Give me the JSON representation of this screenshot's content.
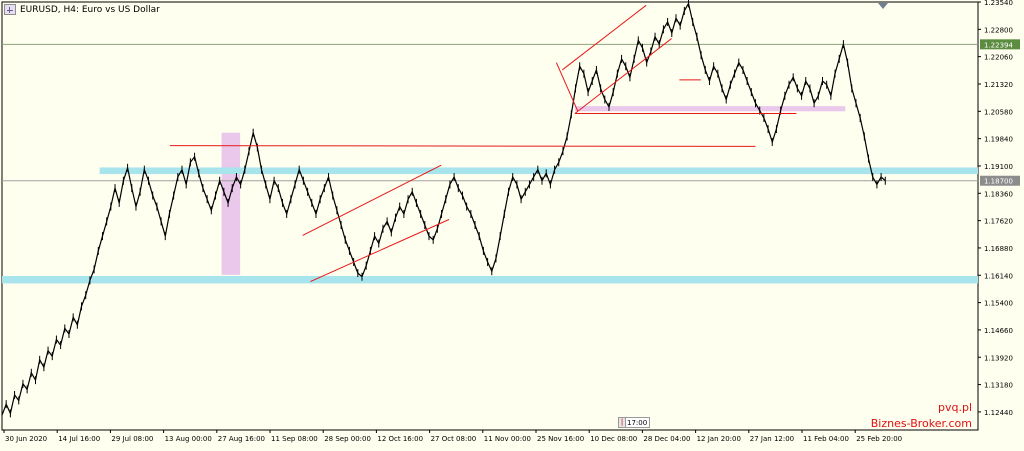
{
  "window": {
    "title": "EURUSD, H4:  Euro vs US Dollar",
    "watermark_line1": "pvq.pl",
    "watermark_line2": "Biznes-Broker.com",
    "scroll_marker_text": "17:00"
  },
  "chart_data": {
    "type": "line",
    "symbol": "EURUSD",
    "timeframe": "H4",
    "description": "Euro vs US Dollar",
    "ylim": [
      1.1195,
      1.2354
    ],
    "y_ticks": [
      "1.23540",
      "1.22800",
      "1.22060",
      "1.21320",
      "1.20580",
      "1.19840",
      "1.19100",
      "1.18360",
      "1.17620",
      "1.16880",
      "1.16140",
      "1.15400",
      "1.14660",
      "1.13920",
      "1.13180",
      "1.12440"
    ],
    "x_ticks": [
      "30 Jun 2020",
      "14 Jul 16:00",
      "29 Jul 08:00",
      "13 Aug 00:00",
      "27 Aug 16:00",
      "11 Sep 08:00",
      "28 Sep 00:00",
      "12 Oct 16:00",
      "27 Oct 08:00",
      "11 Nov 00:00",
      "25 Nov 16:00",
      "10 Dec 08:00",
      "28 Dec 04:00",
      "12 Jan 20:00",
      "27 Jan 12:00",
      "11 Feb 04:00",
      "25 Feb 20:00"
    ],
    "price_labels": [
      {
        "value": 1.22394,
        "text": "1.22394",
        "style": "price-line"
      },
      {
        "value": 1.187,
        "text": "1.18700",
        "style": "current-price"
      }
    ],
    "horizontal_levels": [
      {
        "value": 1.22394,
        "color": "#8fa27a"
      },
      {
        "value": 1.187,
        "color": "#a0a0a0"
      }
    ],
    "zones": [
      {
        "y1": 1.1888,
        "y2": 1.1906,
        "x_start": 0.1,
        "x_end": 1.0,
        "color": "#a8e4ec"
      },
      {
        "y1": 1.1592,
        "y2": 1.1612,
        "x_start": 0.0,
        "x_end": 1.0,
        "color": "#a8e4ec"
      },
      {
        "y1": 1.2058,
        "y2": 1.2072,
        "x_start": 0.587,
        "x_end": 0.864,
        "color": "#e9c8ec"
      }
    ],
    "vertical_zone": {
      "x_start": 0.225,
      "x_end": 0.244,
      "y_top": 1.2,
      "y_bottom": 1.1615,
      "color": "#e9c8ec"
    },
    "trendlines": [
      {
        "x1": 0.172,
        "y1": 1.1965,
        "x2": 0.772,
        "y2": 1.1963
      },
      {
        "x1": 0.308,
        "y1": 1.1722,
        "x2": 0.45,
        "y2": 1.1912
      },
      {
        "x1": 0.316,
        "y1": 1.1597,
        "x2": 0.458,
        "y2": 1.1765
      },
      {
        "x1": 0.574,
        "y1": 1.217,
        "x2": 0.66,
        "y2": 1.2345
      },
      {
        "x1": 0.587,
        "y1": 1.2052,
        "x2": 0.686,
        "y2": 1.2255
      },
      {
        "x1": 0.587,
        "y1": 1.2052,
        "x2": 0.814,
        "y2": 1.2052
      },
      {
        "x1": 0.694,
        "y1": 1.2143,
        "x2": 0.716,
        "y2": 1.2143
      },
      {
        "x1": 0.568,
        "y1": 1.219,
        "x2": 0.59,
        "y2": 1.2058
      }
    ],
    "series": [
      {
        "name": "EURUSD",
        "values": [
          1.1235,
          1.1265,
          1.124,
          1.129,
          1.1275,
          1.132,
          1.1305,
          1.135,
          1.133,
          1.1385,
          1.1365,
          1.141,
          1.1395,
          1.144,
          1.1425,
          1.147,
          1.1455,
          1.15,
          1.148,
          1.153,
          1.156,
          1.16,
          1.163,
          1.168,
          1.172,
          1.176,
          1.18,
          1.185,
          1.181,
          1.187,
          1.1905,
          1.185,
          1.18,
          1.184,
          1.19,
          1.187,
          1.183,
          1.18,
          1.176,
          1.172,
          1.178,
          1.183,
          1.188,
          1.19,
          1.186,
          1.192,
          1.1935,
          1.189,
          1.185,
          1.182,
          1.179,
          1.183,
          1.187,
          1.184,
          1.181,
          1.185,
          1.188,
          1.186,
          1.19,
          1.195,
          1.2,
          1.196,
          1.19,
          1.186,
          1.182,
          1.187,
          1.185,
          1.181,
          1.178,
          1.182,
          1.186,
          1.19,
          1.187,
          1.184,
          1.181,
          1.178,
          1.182,
          1.185,
          1.188,
          1.183,
          1.179,
          1.175,
          1.171,
          1.168,
          1.165,
          1.162,
          1.161,
          1.164,
          1.168,
          1.172,
          1.17,
          1.174,
          1.176,
          1.173,
          1.177,
          1.18,
          1.178,
          1.182,
          1.184,
          1.181,
          1.178,
          1.175,
          1.172,
          1.171,
          1.174,
          1.178,
          1.182,
          1.186,
          1.188,
          1.185,
          1.183,
          1.18,
          1.178,
          1.175,
          1.172,
          1.168,
          1.165,
          1.1625,
          1.166,
          1.172,
          1.178,
          1.184,
          1.188,
          1.186,
          1.182,
          1.184,
          1.186,
          1.188,
          1.19,
          1.187,
          1.189,
          1.186,
          1.19,
          1.192,
          1.195,
          1.199,
          1.205,
          1.212,
          1.218,
          1.216,
          1.211,
          1.214,
          1.217,
          1.212,
          1.209,
          1.207,
          1.211,
          1.216,
          1.22,
          1.218,
          1.215,
          1.22,
          1.225,
          1.223,
          1.219,
          1.222,
          1.226,
          1.224,
          1.228,
          1.23,
          1.227,
          1.231,
          1.229,
          1.233,
          1.235,
          1.23,
          1.226,
          1.221,
          1.217,
          1.214,
          1.218,
          1.216,
          1.212,
          1.209,
          1.213,
          1.216,
          1.219,
          1.217,
          1.214,
          1.211,
          1.208,
          1.206,
          1.204,
          1.201,
          1.1975,
          1.201,
          1.206,
          1.21,
          1.213,
          1.215,
          1.212,
          1.21,
          1.214,
          1.212,
          1.208,
          1.21,
          1.214,
          1.213,
          1.21,
          1.216,
          1.22,
          1.224,
          1.219,
          1.212,
          1.208,
          1.204,
          1.199,
          1.193,
          1.188,
          1.186,
          1.188,
          1.187
        ]
      }
    ]
  }
}
